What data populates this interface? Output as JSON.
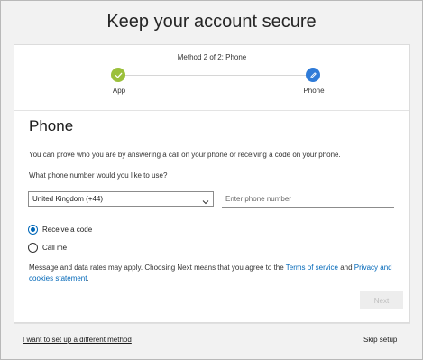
{
  "page": {
    "title": "Keep your account secure"
  },
  "stepper": {
    "method_label": "Method 2 of 2: Phone",
    "steps": [
      {
        "label": "App",
        "status": "complete",
        "icon": "check-icon",
        "color": "#9bc03b"
      },
      {
        "label": "Phone",
        "status": "current",
        "icon": "pencil-icon",
        "color": "#2f7bd8"
      }
    ]
  },
  "section": {
    "heading": "Phone",
    "description": "You can prove who you are by answering a call on your phone or receiving a code on your phone.",
    "question": "What phone number would you like to use?"
  },
  "form": {
    "country_selected": "United Kingdom (+44)",
    "phone_value": "",
    "phone_placeholder": "Enter phone number",
    "options": [
      {
        "label": "Receive a code",
        "selected": true
      },
      {
        "label": "Call me",
        "selected": false
      }
    ]
  },
  "legal": {
    "prefix": "Message and data rates may apply. Choosing Next means that you agree to the ",
    "terms_link": "Terms of service",
    "middle": " and ",
    "privacy_link": "Privacy and cookies statement",
    "suffix": "."
  },
  "actions": {
    "next_label": "Next",
    "next_enabled": false
  },
  "footer": {
    "alternate_method_link": "I want to set up a different method",
    "skip_link": "Skip setup"
  },
  "colors": {
    "accent": "#0067b8",
    "app_step": "#9bc03b",
    "phone_step": "#2f7bd8"
  }
}
